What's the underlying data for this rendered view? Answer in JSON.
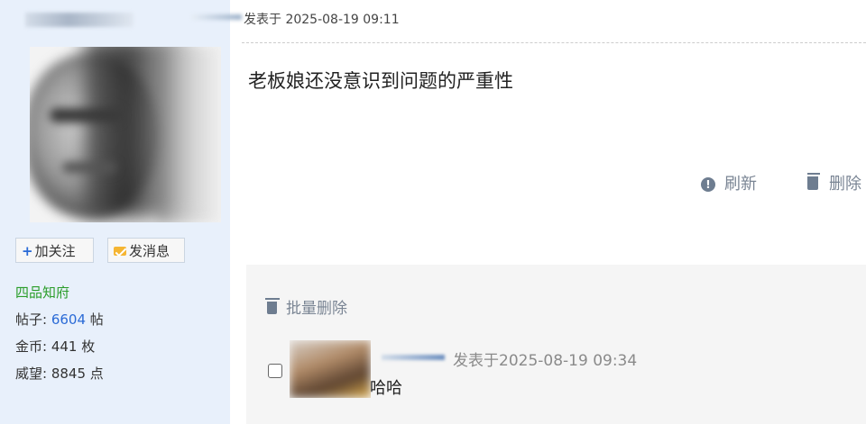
{
  "user": {
    "follow_label": "加关注",
    "message_label": "发消息",
    "rank": "四品知府",
    "posts_label": "帖子: ",
    "posts_value": "6604",
    "posts_unit": " 帖",
    "coins": "金币: 441 枚",
    "prestige": "威望: 8845 点"
  },
  "post": {
    "timestamp": "发表于 2025-08-19 09:11",
    "body": "老板娘还没意识到问题的严重性",
    "actions": {
      "refresh": "刷新",
      "delete": "删除"
    }
  },
  "replies": {
    "batch_delete": "批量删除",
    "items": [
      {
        "timestamp": "发表于2025-08-19 09:34",
        "text": "哈哈"
      }
    ]
  },
  "colors": {
    "rank": "#2a9d2a",
    "link": "#2a6ad6",
    "sidebar_bg": "#e8f0fb",
    "reply_bg": "#f5f5f5"
  }
}
